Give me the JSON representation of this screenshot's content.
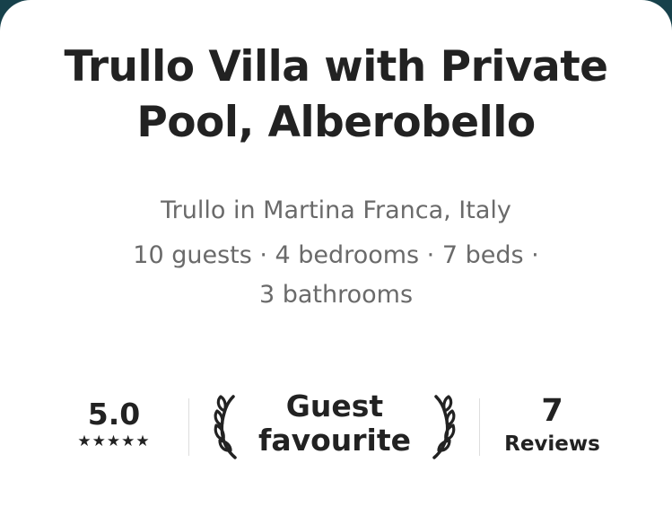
{
  "listing": {
    "title_line1": "Trullo Villa with Private",
    "title_line2": "Pool, Alberobello",
    "subtitle": "Trullo in Martina Franca, Italy",
    "details_line1": "10 guests · 4 bedrooms · 7 beds ·",
    "details_line2": "3 bathrooms"
  },
  "stats": {
    "rating": "5.0",
    "stars": "★★★★★",
    "star_count": 5,
    "badge_line1": "Guest",
    "badge_line2": "favourite",
    "reviews_count": "7",
    "reviews_label": "Reviews"
  },
  "icons": {
    "laurel_left": "laurel-left-icon",
    "laurel_right": "laurel-right-icon",
    "star": "star-icon"
  },
  "colors": {
    "text_primary": "#222222",
    "text_secondary": "#6a6a6a",
    "divider": "#dddddd",
    "backdrop": "#17414b"
  }
}
